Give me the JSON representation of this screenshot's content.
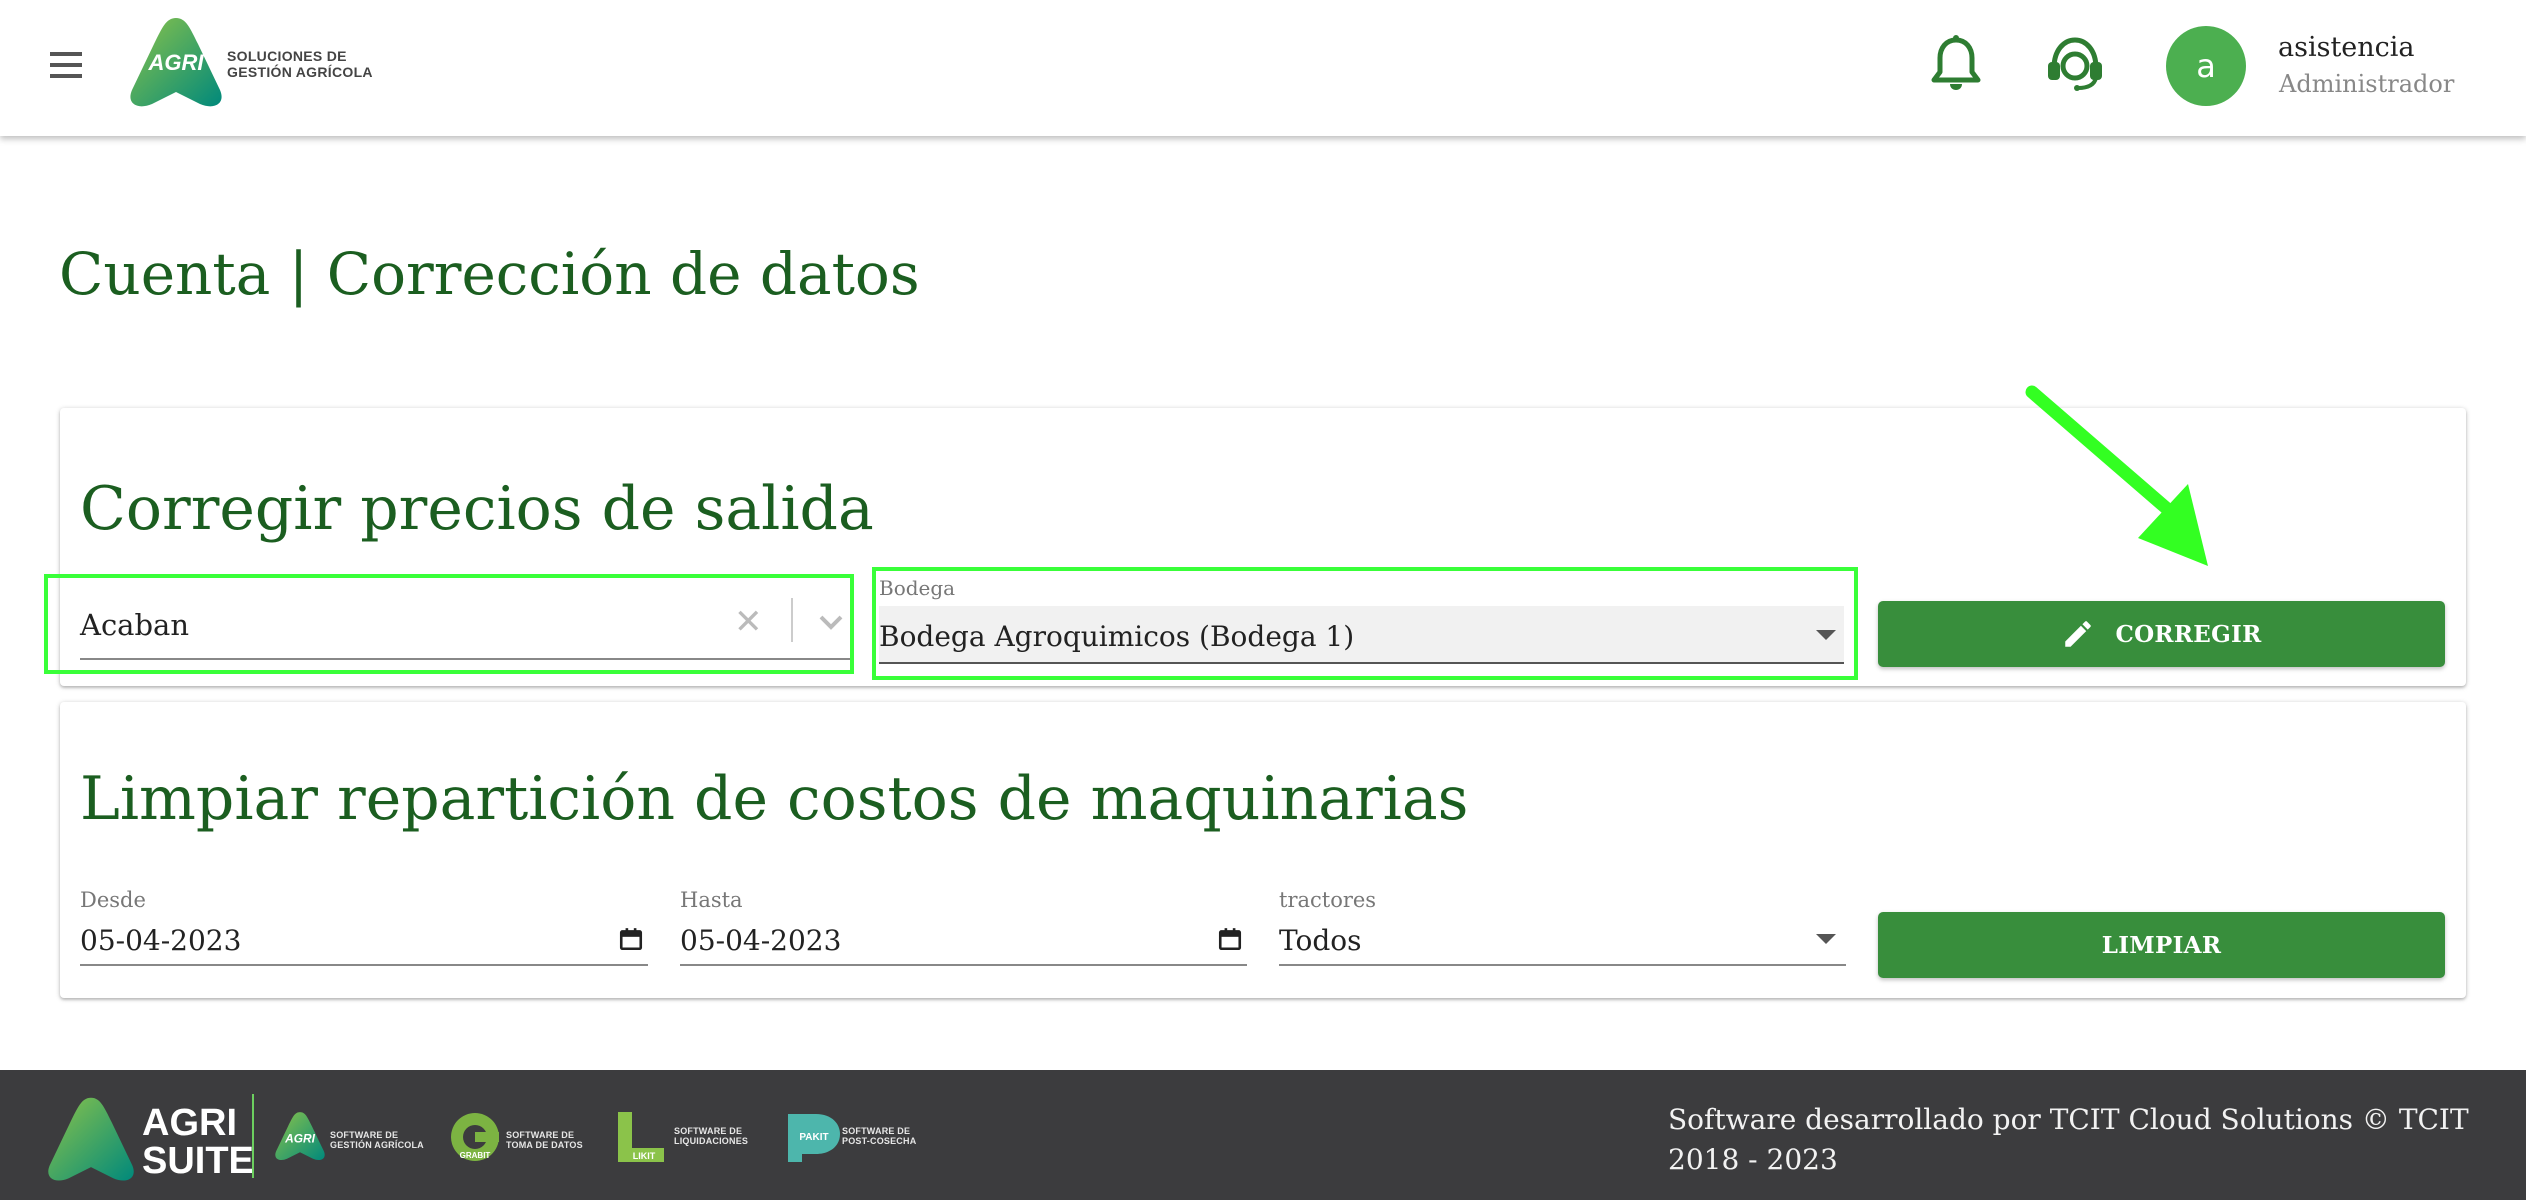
{
  "header": {
    "logo_word": "AGRI",
    "logo_tagline_line1": "SOLUCIONES DE",
    "logo_tagline_line2": "GESTIÓN AGRÍCOLA",
    "avatar_letter": "a",
    "user_name": "asistencia",
    "user_role": "Administrador",
    "icons": [
      "menu-icon",
      "bell-icon",
      "headset-support-icon"
    ]
  },
  "page": {
    "title": "Cuenta | Corrección de datos"
  },
  "correct_prices": {
    "title": "Corregir precios de salida",
    "product_select_value": "Acaban",
    "bodega_label": "Bodega",
    "bodega_value": "Bodega Agroquimicos (Bodega 1)",
    "button_label": "CORREGIR"
  },
  "clean_costs": {
    "title": "Limpiar repartición de costos de maquinarias",
    "desde_label": "Desde",
    "desde_value": "05-04-2023",
    "hasta_label": "Hasta",
    "hasta_value": "05-04-2023",
    "tractores_label": "tractores",
    "tractores_value": "Todos",
    "button_label": "LIMPIAR"
  },
  "footer": {
    "brand_line1": "AGRI",
    "brand_line2": "SUITE",
    "products": [
      {
        "logo": "AGRI",
        "line1": "SOFTWARE DE",
        "line2": "GESTIÓN AGRÍCOLA"
      },
      {
        "logo": "GRABIT",
        "line1": "SOFTWARE DE",
        "line2": "TOMA DE DATOS"
      },
      {
        "logo": "LIKIT",
        "line1": "SOFTWARE DE",
        "line2": "LIQUIDACIONES"
      },
      {
        "logo": "PAKIT",
        "line1": "SOFTWARE DE",
        "line2": "POST-COSECHA"
      }
    ],
    "credit": "Software desarrollado por TCIT Cloud Solutions © TCIT 2018 - 2023"
  },
  "colors": {
    "primary_green": "#388e3c",
    "title_green": "#1b5e20",
    "highlight": "#39ff39",
    "footer_bg": "#3c3c3e"
  }
}
